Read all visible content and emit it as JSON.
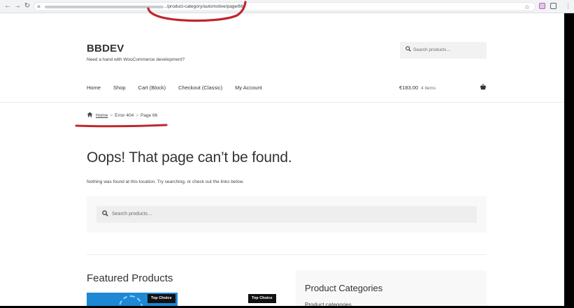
{
  "browser": {
    "back_icon": "arrow-left-icon",
    "forward_icon": "arrow-right-icon",
    "reload_icon": "reload-icon",
    "site_info_icon": "tune-icon",
    "url_visible": "../product-category/automotive/page/66/",
    "bookmark_icon": "star-icon",
    "menu_icon": "more-vert-icon"
  },
  "site": {
    "title": "BBDEV",
    "tagline": "Need a hand with WooCommerce development?"
  },
  "header_search": {
    "placeholder": "Search products…"
  },
  "nav": {
    "items": [
      "Home",
      "Shop",
      "Cart (Block)",
      "Checkout (Classic)",
      "My Account"
    ]
  },
  "cart": {
    "total": "€183.00",
    "count": "4 items"
  },
  "breadcrumb": {
    "items": [
      "Home",
      "Error 404",
      "Page 66"
    ],
    "separator": ">"
  },
  "content": {
    "heading": "Oops! That page can’t be found.",
    "description": "Nothing was found at this location. Try searching, or check out the links below.",
    "search_placeholder": "Search products…"
  },
  "featured": {
    "title": "Featured Products",
    "badges": [
      "Top Choice",
      "Top Choice"
    ]
  },
  "categories": {
    "title": "Product Categories",
    "select_label": "Product categories"
  },
  "colors": {
    "annotation_red": "#c0262d",
    "product_blue": "#1e88d4",
    "text": "#43454b"
  }
}
